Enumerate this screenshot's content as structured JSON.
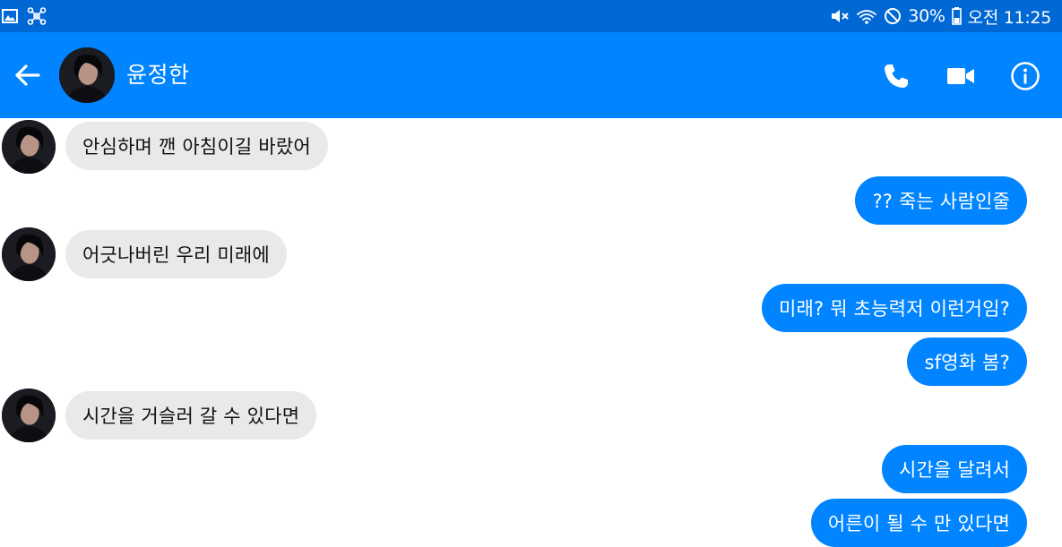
{
  "status_bar": {
    "battery": "30%",
    "clock": "오전 11:25",
    "left_icons": [
      "gallery-icon",
      "network-hub-icon"
    ],
    "right_icons": [
      "mute-icon",
      "wifi-icon",
      "do-not-disturb-icon",
      "battery-icon"
    ]
  },
  "header": {
    "contact_name": "윤정한",
    "actions": [
      "back-arrow-icon",
      "phone-icon",
      "video-camera-icon",
      "info-icon"
    ]
  },
  "colors": {
    "status_bar": "#0068d4",
    "app_bar": "#0084ff",
    "outgoing_bubble": "#0084ff",
    "incoming_bubble": "#e9e9eb"
  },
  "messages": [
    {
      "direction": "incoming",
      "text": "안심하며 깬 아침이길 바랐어"
    },
    {
      "direction": "outgoing",
      "text": "?? 죽는 사람인줄"
    },
    {
      "direction": "incoming",
      "text": "어긋나버린 우리 미래에"
    },
    {
      "direction": "outgoing",
      "text": "미래? 뭐 초능력저 이런거임?"
    },
    {
      "direction": "outgoing",
      "text": "sf영화 봄?"
    },
    {
      "direction": "incoming",
      "text": "시간을 거슬러 갈 수 있다면"
    },
    {
      "direction": "outgoing",
      "text": "시간을 달려서"
    },
    {
      "direction": "outgoing",
      "text": "어른이 될 수 만 있다면"
    }
  ]
}
